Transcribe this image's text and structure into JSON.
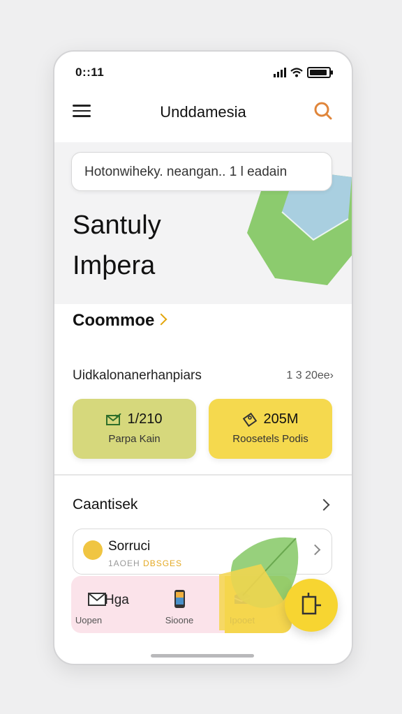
{
  "status": {
    "time": "0::11"
  },
  "appbar": {
    "title": "Unddamesia",
    "menu_icon": "hamburger-menu-icon",
    "search_icon": "search-icon"
  },
  "hero": {
    "search_text": "Hotonwiheky. neangan.. 1  l eadain",
    "title_line1": "Santuly",
    "title_line2": "Imþera"
  },
  "section_link": {
    "label": "Coommoe"
  },
  "stats": {
    "label": "Uidkalonanerhanpiars",
    "meta": "1 3 20ee›",
    "cards": [
      {
        "value": "1/210",
        "caption": "Parpa Kain",
        "icon": "envelope-check-icon",
        "color": "#d6d87c"
      },
      {
        "value": "205M",
        "caption": "Roosetels Podis",
        "icon": "tag-icon",
        "color": "#f5d94e"
      }
    ]
  },
  "list_section": {
    "label": "Caantisek",
    "item": {
      "title": "Sorruci",
      "sub_a": "1AOEH",
      "sub_b": "DBSGES"
    }
  },
  "bottom_nav": {
    "tabs": [
      {
        "label": "Uopen",
        "side": "Hga",
        "icon": "mail-icon"
      },
      {
        "label": "Sioone",
        "icon": "phone-icon"
      },
      {
        "label": "Ipooet",
        "icon": "inbox-icon"
      }
    ]
  },
  "fab": {
    "icon": "compose-icon"
  },
  "colors": {
    "accent": "#f5d94e",
    "hero_bg": "#f3f3f4",
    "edge_accent": "#2f78c4"
  }
}
